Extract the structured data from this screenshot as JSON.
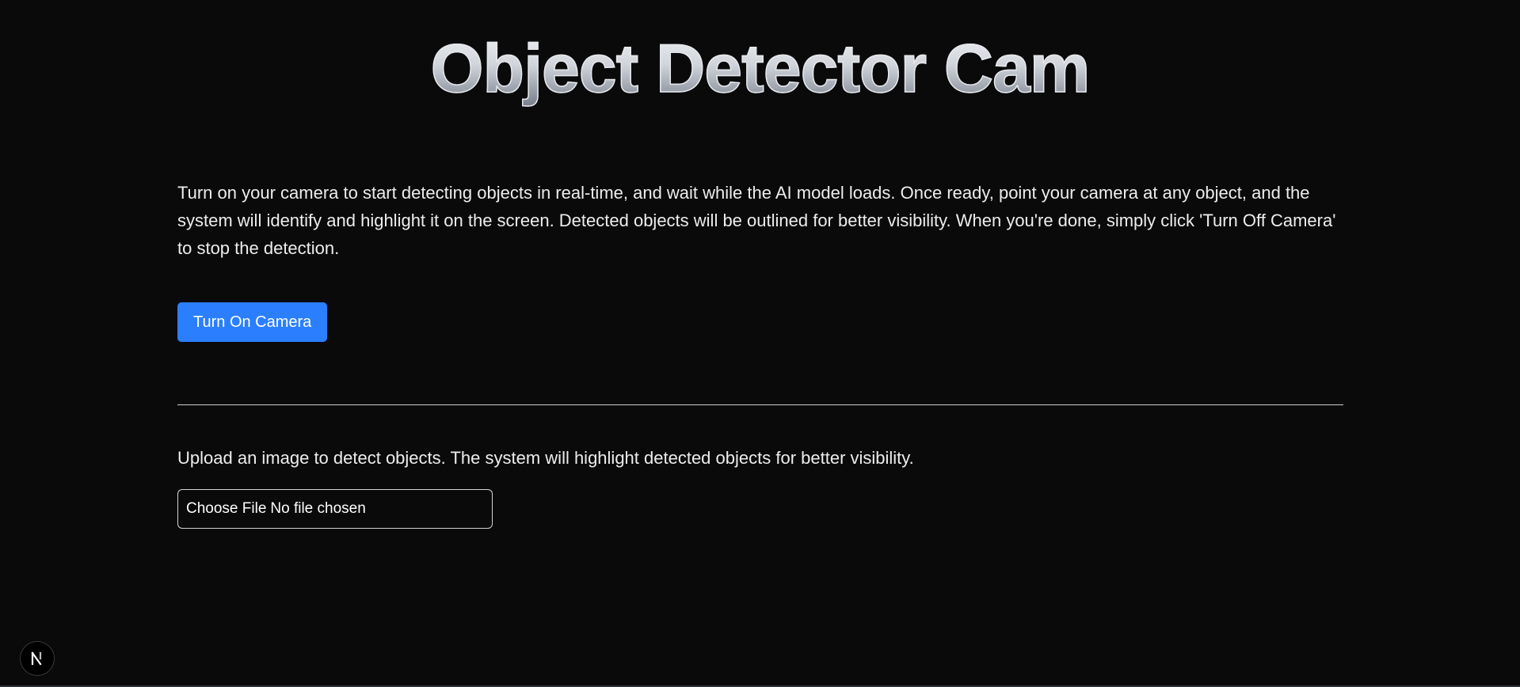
{
  "header": {
    "title": "Object Detector Cam"
  },
  "camera_section": {
    "description": "Turn on your camera to start detecting objects in real-time, and wait while the AI model loads. Once ready, point your camera at any object, and the system will identify and highlight it on the screen. Detected objects will be outlined for better visibility. When you're done, simply click 'Turn Off Camera' to stop the detection.",
    "button_label": "Turn On Camera"
  },
  "upload_section": {
    "description": "Upload an image to detect objects. The system will highlight detected objects for better visibility.",
    "file_button_label": "Choose File",
    "file_status": "No file chosen"
  },
  "dev_badge": {
    "icon": "nextjs-logo-icon",
    "letter": "N"
  },
  "colors": {
    "background": "#0a0a0a",
    "accent_button": "#2b7fff",
    "text": "#ededed"
  }
}
